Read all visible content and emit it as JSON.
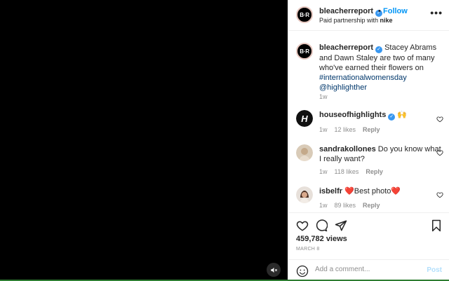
{
  "post": {
    "username": "bleacherreport",
    "follow_label": "Follow",
    "follow_sep": "•",
    "partnership_prefix": "Paid partnership with ",
    "partner": "nike",
    "more_label": "•••",
    "logo_text": "B·R"
  },
  "caption": {
    "username": "bleacherreport",
    "text": "Stacey Abrams and Dawn Staley are two of many who've earned their flowers on ",
    "hashtag": "#internationalwomensday",
    "mention": "@highlighther",
    "time": "1w"
  },
  "comments": [
    {
      "username": "houseofhighlights",
      "text": "🙌",
      "time": "1w",
      "likes": "12 likes",
      "reply": "Reply",
      "avatar_text": "H"
    },
    {
      "username": "sandrakollones",
      "text": "Do you know what I really want?",
      "time": "1w",
      "likes": "118 likes",
      "reply": "Reply"
    },
    {
      "username": "isbelfr",
      "text": "❤️Best photo❤️",
      "time": "1w",
      "likes": "89 likes",
      "reply": "Reply"
    }
  ],
  "stats": {
    "views": "459,782 views",
    "date": "MARCH 8"
  },
  "composer": {
    "placeholder": "Add a comment...",
    "post_label": "Post"
  },
  "colors": {
    "accent": "#0095f6",
    "verified": "#3897f0",
    "muted": "#8e8e8e",
    "media_bg": "#000000"
  }
}
